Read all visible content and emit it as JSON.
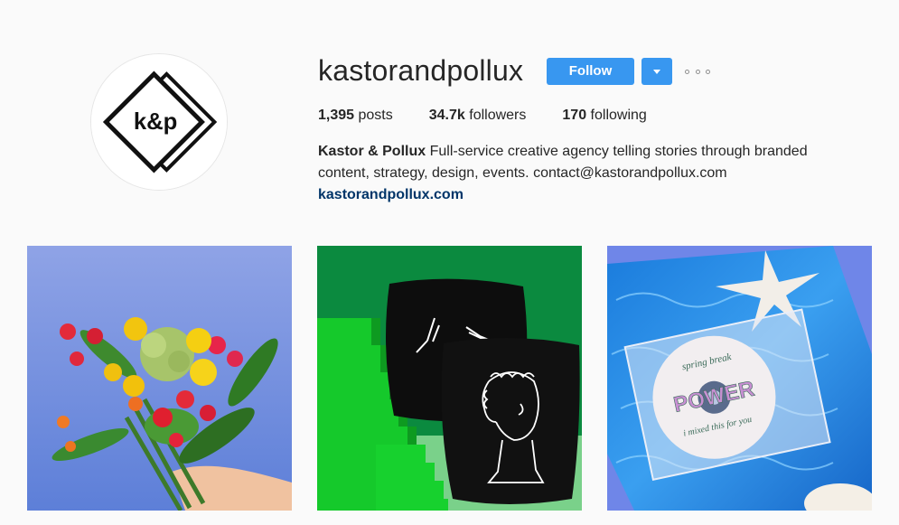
{
  "profile": {
    "username": "kastorandpollux",
    "avatar_text": "k&p",
    "follow_label": "Follow",
    "stats": [
      {
        "count": "1,395",
        "label": "posts"
      },
      {
        "count": "34.7k",
        "label": "followers"
      },
      {
        "count": "170",
        "label": "following"
      }
    ],
    "bio": {
      "name": "Kastor & Pollux",
      "text": "Full-service creative agency telling stories through branded content, strategy, design, events. contact@kastorandpollux.com",
      "link": "kastorandpollux.com"
    }
  },
  "colors": {
    "accent": "#3897f0",
    "link": "#003569",
    "background": "#fafafa"
  },
  "icons": {
    "dropdown": "chevron-down-icon",
    "more": "more-options-icon"
  },
  "posts": [
    {
      "subject": "flower-bouquet-photo"
    },
    {
      "subject": "black-pillows-photo"
    },
    {
      "subject": "cd-on-water-photo"
    }
  ],
  "post_texts": {
    "cd_line1": "spring break",
    "cd_line2": "POWER",
    "cd_line3": "i mixed this for you"
  }
}
